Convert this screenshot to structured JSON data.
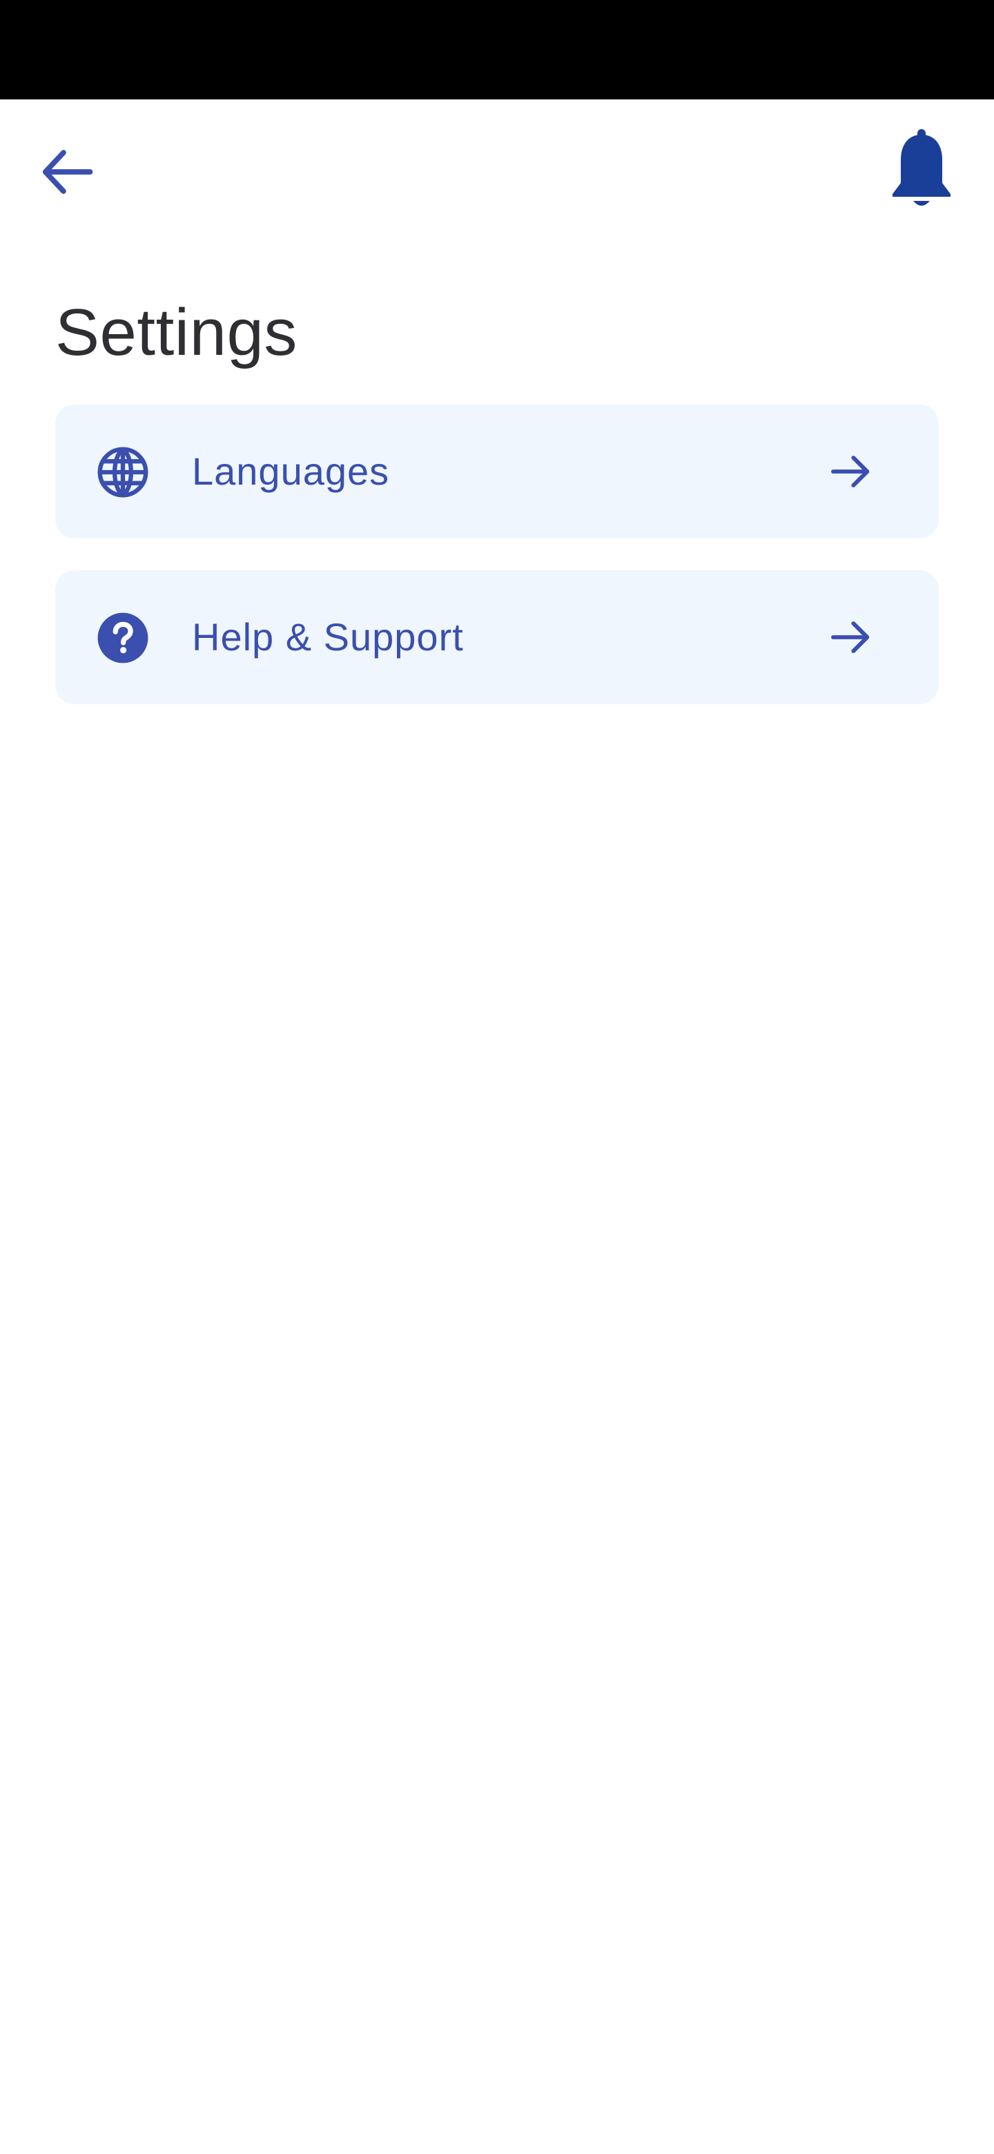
{
  "colors": {
    "accent": "#3a4fae",
    "bell": "#1a3f99",
    "card_bg": "#f0f6fe",
    "title": "#2f2f33",
    "status_bar": "#000000"
  },
  "header": {
    "back_icon": "arrow-left-icon",
    "notification_icon": "bell-icon"
  },
  "page": {
    "title": "Settings"
  },
  "settings": {
    "items": [
      {
        "label": "Languages",
        "icon": "globe-icon",
        "trailing_icon": "arrow-right-icon"
      },
      {
        "label": "Help & Support",
        "icon": "help-circle-icon",
        "trailing_icon": "arrow-right-icon"
      }
    ]
  }
}
